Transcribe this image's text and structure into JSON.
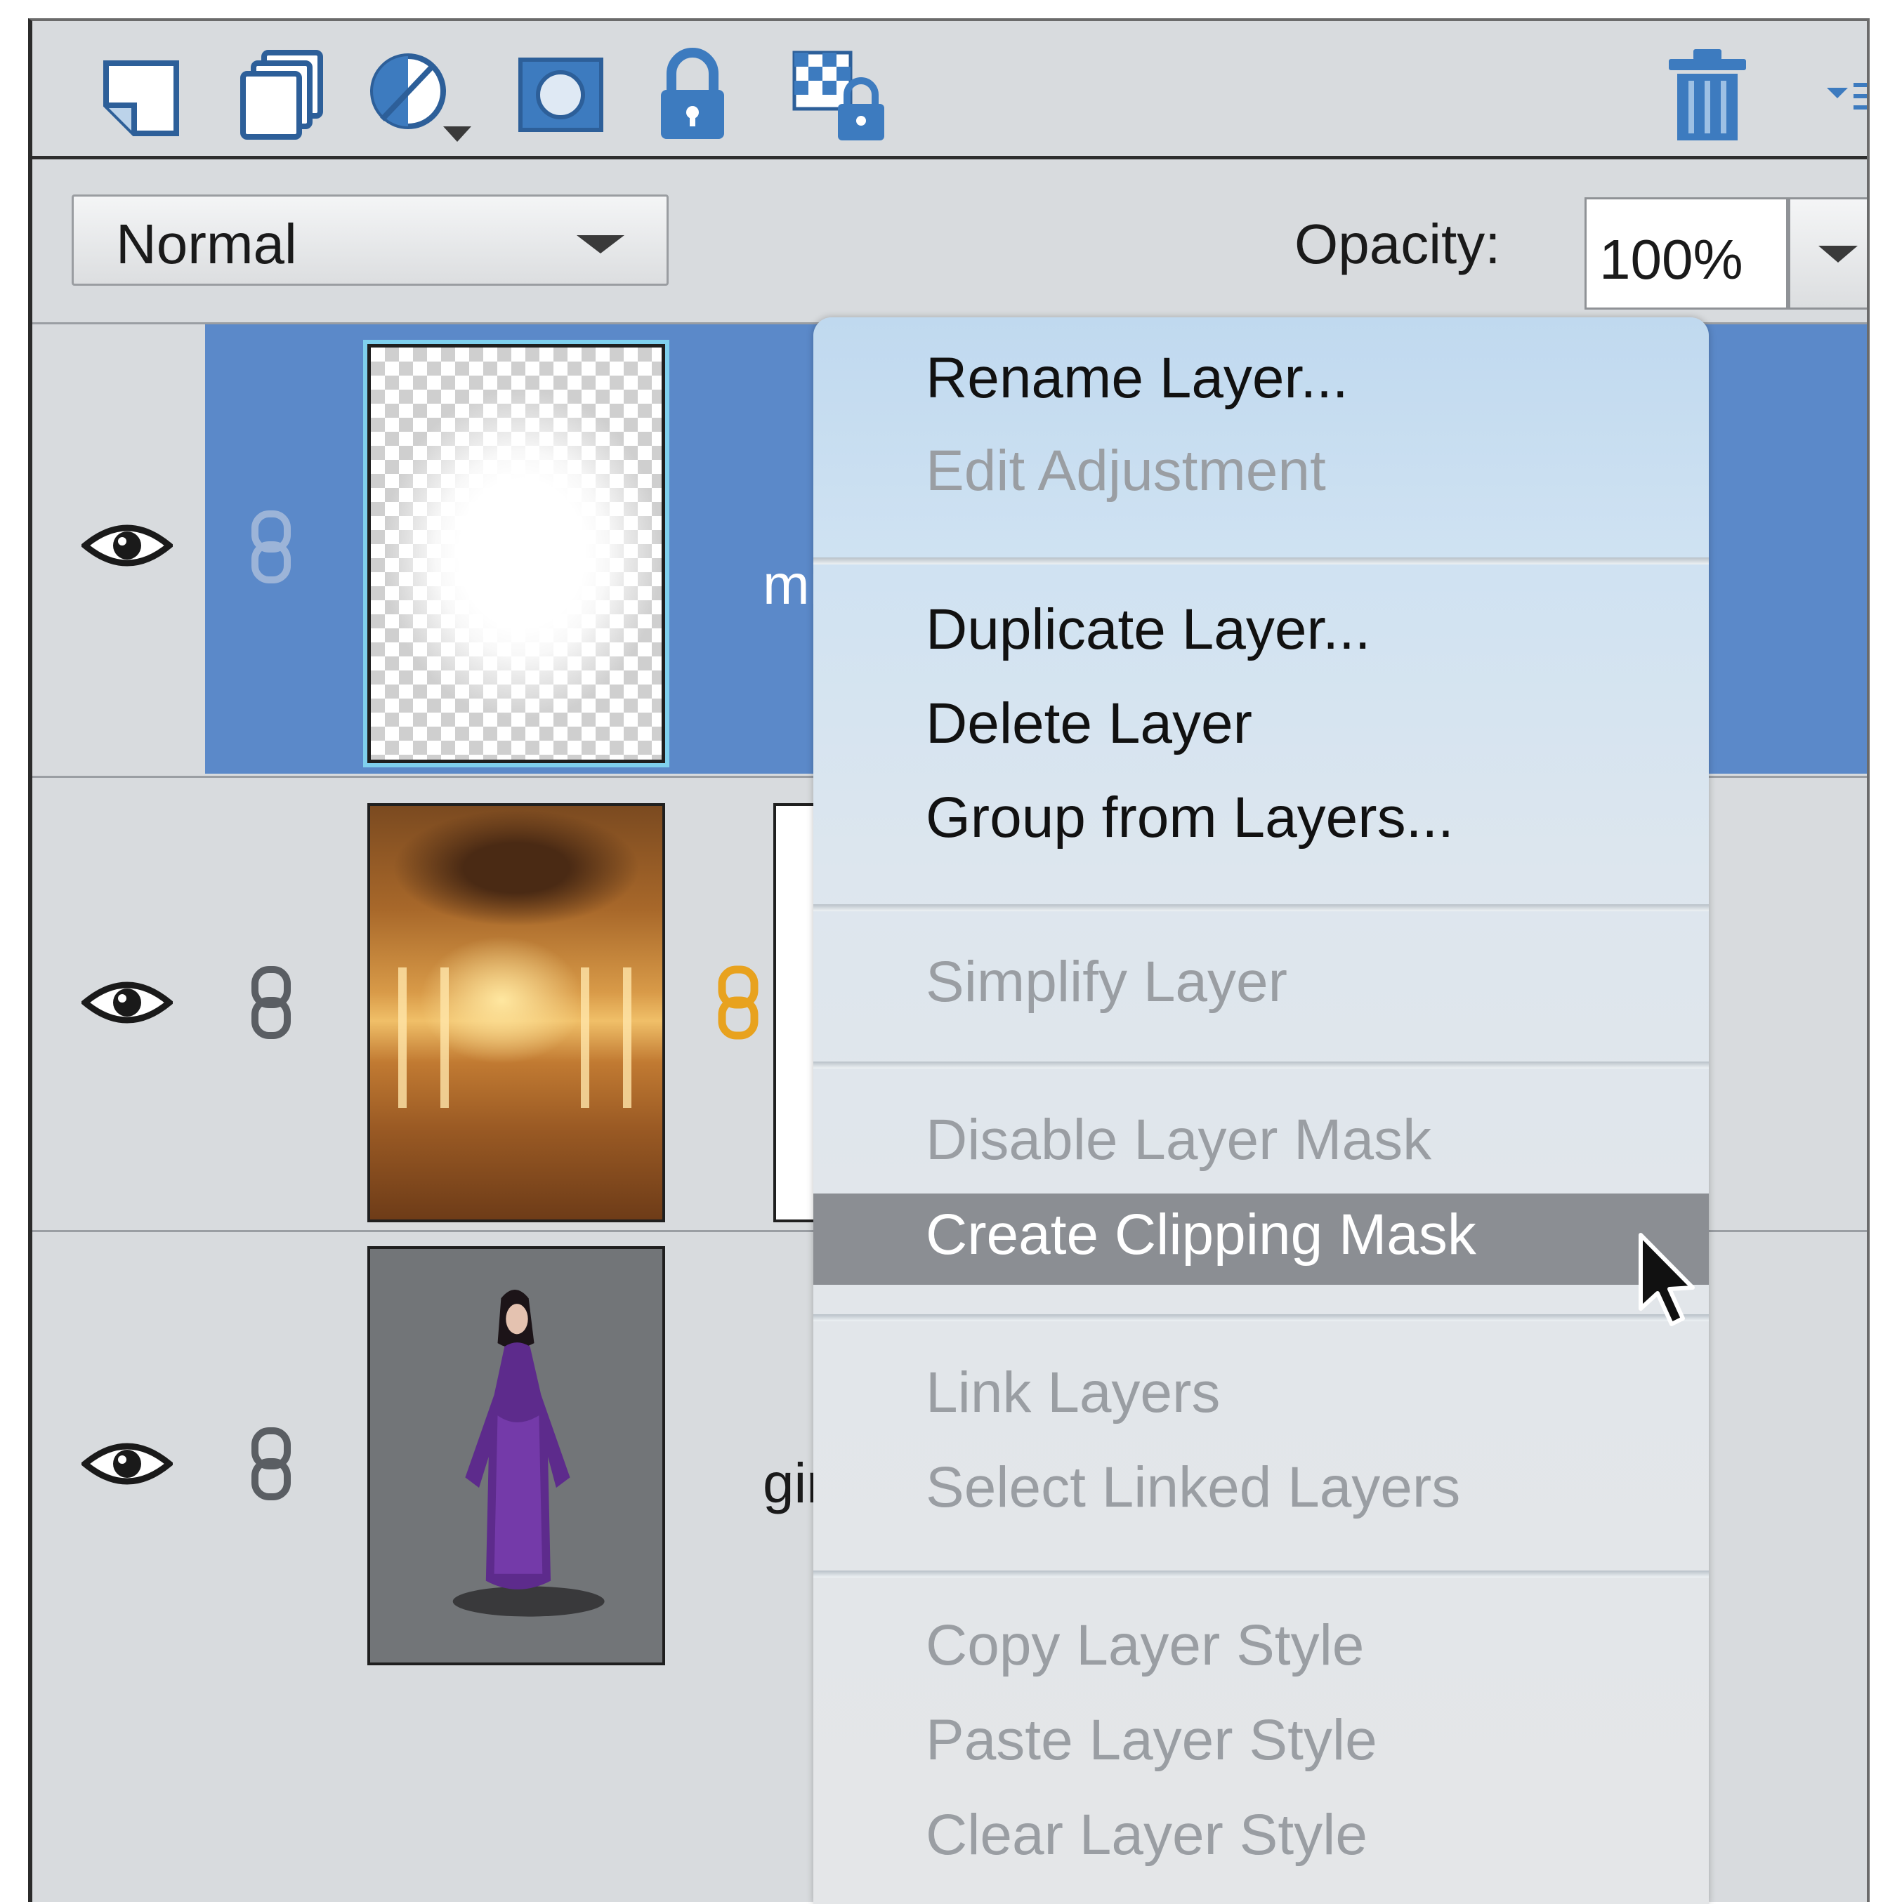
{
  "toolbar": {
    "icons": [
      "new-layer-icon",
      "new-group-icon",
      "adjustment-layer-icon",
      "add-mask-icon",
      "lock-all-icon",
      "lock-transparency-icon",
      "trash-icon",
      "panel-menu-icon"
    ]
  },
  "blend_mode": {
    "value": "Normal"
  },
  "opacity": {
    "label": "Opacity:",
    "value": "100%"
  },
  "layers": [
    {
      "name_visible": "mi",
      "selected": true,
      "thumb": "transparent-glow"
    },
    {
      "name_visible": "",
      "selected": false,
      "thumb": "ballroom",
      "has_mask": true
    },
    {
      "name_visible": "gir",
      "selected": false,
      "thumb": "girl-in-purple-dress"
    }
  ],
  "menu": {
    "rename_layer": "Rename Layer...",
    "edit_adjustment": "Edit Adjustment",
    "duplicate_layer": "Duplicate Layer...",
    "delete_layer": "Delete Layer",
    "group_from_layers": "Group from Layers...",
    "simplify_layer": "Simplify Layer",
    "disable_layer_mask": "Disable Layer Mask",
    "create_clipping_mask": "Create Clipping Mask",
    "link_layers": "Link Layers",
    "select_linked_layers": "Select Linked Layers",
    "copy_layer_style": "Copy Layer Style",
    "paste_layer_style": "Paste Layer Style",
    "clear_layer_style": "Clear Layer Style",
    "highlighted": "Create Clipping Mask"
  },
  "colors": {
    "panel": "#d8dbde",
    "selection": "#5b89c9",
    "highlight": "#8b8e93",
    "icon_blue": "#3d7bbf"
  }
}
